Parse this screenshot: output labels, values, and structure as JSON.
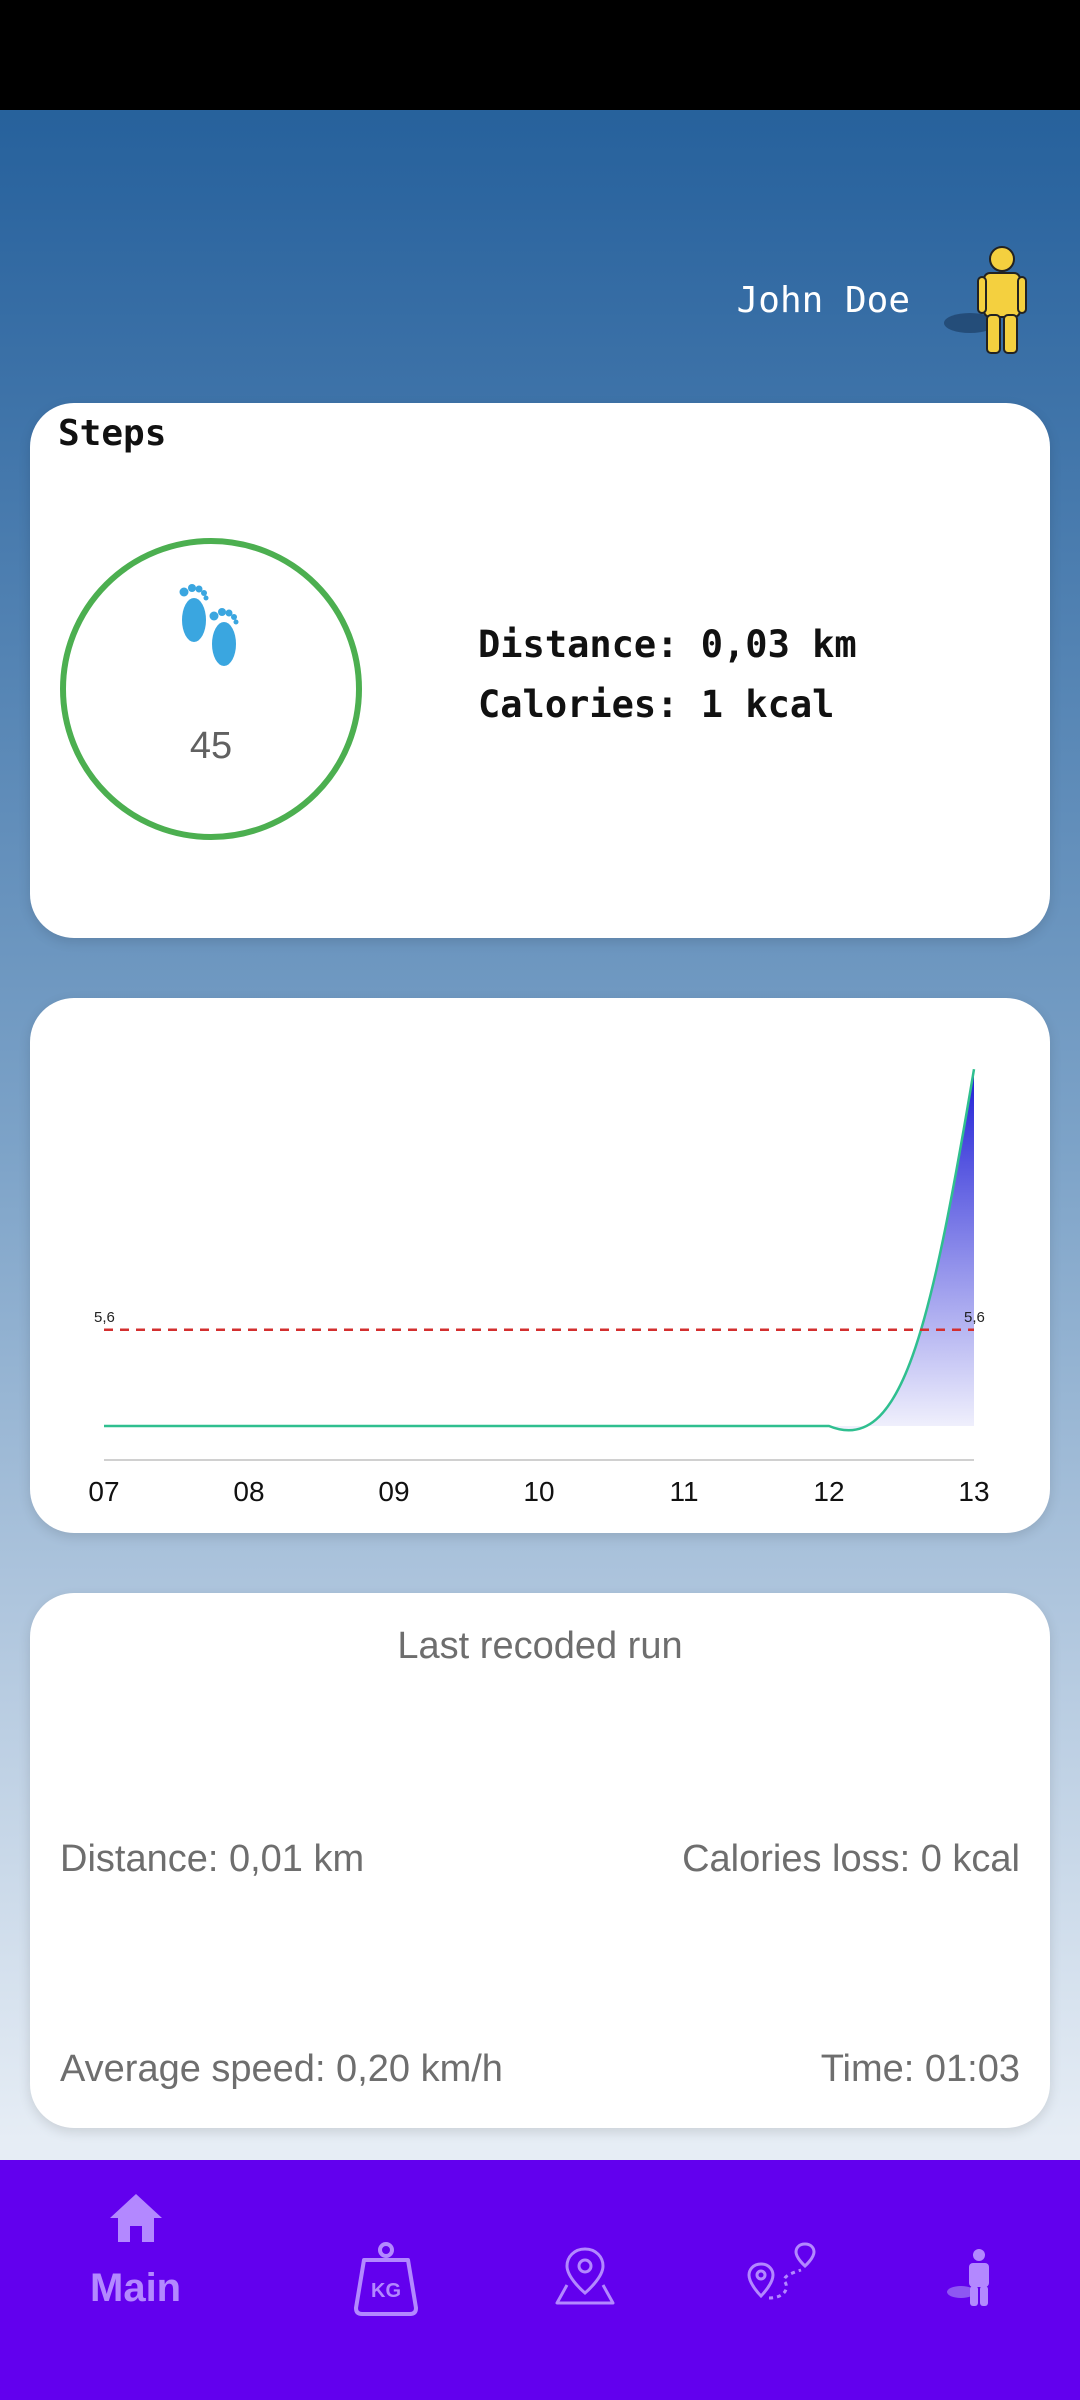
{
  "user": {
    "name": "John Doe",
    "avatar_icon": "person-icon"
  },
  "steps_card": {
    "title": "Steps",
    "count": "45",
    "distance_text": "Distance: 0,03 km",
    "calories_text": "Calories: 1 kcal",
    "icon": "footprints-icon",
    "ring_color": "#4caf50"
  },
  "chart_data": {
    "type": "area",
    "categories": [
      "07",
      "08",
      "09",
      "10",
      "11",
      "12",
      "13"
    ],
    "values": [
      0,
      0,
      0,
      0,
      0,
      0,
      39
    ],
    "reference_line": {
      "value": 5.6,
      "label_left": "5,6",
      "label_right": "5,6",
      "color": "#d32f2f",
      "style": "dashed"
    },
    "line_color": "#2fbf8f",
    "fill_color": "#1f1fd6",
    "grid": false,
    "legend": "none"
  },
  "run_card": {
    "title": "Last recoded run",
    "distance": "Distance: 0,01 km",
    "calories": "Calories loss: 0 kcal",
    "avg_speed": "Average speed: 0,20 km/h",
    "time": "Time: 01:03"
  },
  "nav": {
    "items": [
      {
        "label": "Main",
        "icon": "home-icon",
        "active": true
      },
      {
        "label": "",
        "icon": "weight-kg-icon"
      },
      {
        "label": "",
        "icon": "map-pin-icon"
      },
      {
        "label": "",
        "icon": "route-icon"
      },
      {
        "label": "",
        "icon": "person-icon"
      }
    ],
    "color": "#6200ee"
  }
}
